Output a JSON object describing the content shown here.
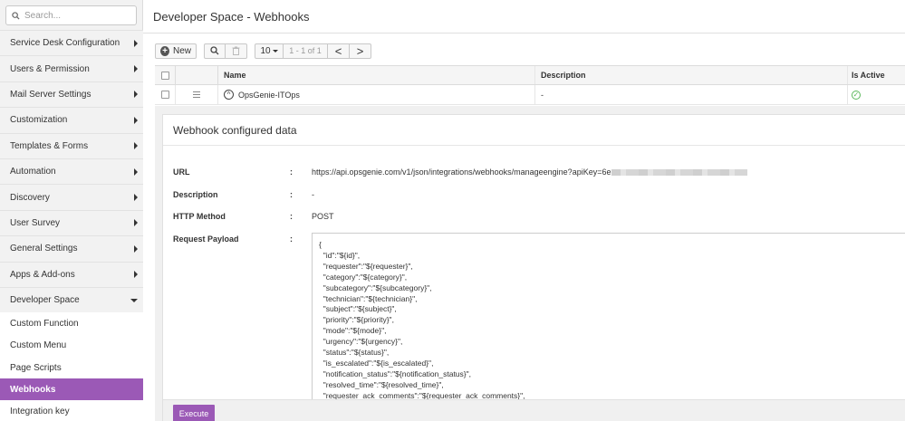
{
  "sidebar": {
    "search_placeholder": "Search...",
    "items": [
      {
        "label": "Service Desk Configuration"
      },
      {
        "label": "Users & Permission"
      },
      {
        "label": "Mail Server Settings"
      },
      {
        "label": "Customization"
      },
      {
        "label": "Templates & Forms"
      },
      {
        "label": "Automation"
      },
      {
        "label": "Discovery"
      },
      {
        "label": "User Survey"
      },
      {
        "label": "General Settings"
      },
      {
        "label": "Apps & Add-ons"
      },
      {
        "label": "Developer Space"
      }
    ],
    "sub_items": [
      {
        "label": "Custom Function"
      },
      {
        "label": "Custom Menu"
      },
      {
        "label": "Page Scripts"
      },
      {
        "label": "Webhooks"
      },
      {
        "label": "Integration key"
      }
    ]
  },
  "header": {
    "title": "Developer Space - Webhooks"
  },
  "toolbar": {
    "new_label": "New",
    "page_size": "10",
    "range": "1 - 1 of 1",
    "prev": "<",
    "next": ">"
  },
  "table": {
    "columns": {
      "name": "Name",
      "description": "Description",
      "is_active": "Is Active"
    },
    "rows": [
      {
        "name": "OpsGenie-ITOps",
        "description": "-"
      }
    ]
  },
  "detail": {
    "title": "Webhook configured data",
    "fields": {
      "url_label": "URL",
      "url_value": "https://api.opsgenie.com/v1/json/integrations/webhooks/manageengine?apiKey=6e",
      "description_label": "Description",
      "description_value": "-",
      "method_label": "HTTP Method",
      "method_value": "POST",
      "payload_label": "Request Payload",
      "colon": ":"
    },
    "payload_lines": [
      "{",
      "  \"id\":\"${id}\",",
      "  \"requester\":\"${requester}\",",
      "  \"category\":\"${category}\",",
      "  \"subcategory\":\"${subcategory}\",",
      "  \"technician\":\"${technician}\",",
      "  \"subject\":\"${subject}\",",
      "  \"priority\":\"${priority}\",",
      "  \"mode\":\"${mode}\",",
      "  \"urgency\":\"${urgency}\",",
      "  \"status\":\"${status}\",",
      "  \"is_escalated\":\"${is_escalated}\",",
      "  \"notification_status\":\"${notification_status}\",",
      "  \"resolved_time\":\"${resolved_time}\",",
      "  \"requester_ack_comments\":\"${requester_ack_comments}\","
    ],
    "execute_label": "Execute"
  },
  "colors": {
    "accent": "#9b59b6",
    "active_check": "#5cb85c"
  }
}
